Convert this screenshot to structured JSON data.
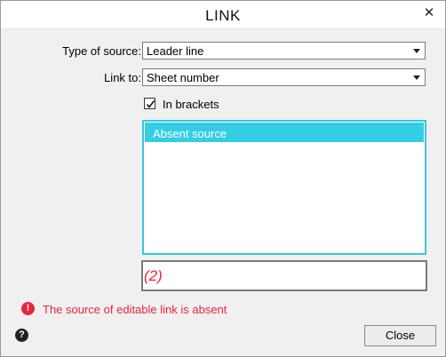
{
  "dialog": {
    "title": "LINK",
    "close_icon": "close-icon"
  },
  "form": {
    "type_of_source": {
      "label": "Type of source:",
      "value": "Leader line"
    },
    "link_to": {
      "label": "Link to:",
      "value": "Sheet number"
    },
    "in_brackets": {
      "label": "In brackets",
      "checked": true
    }
  },
  "source_list": {
    "items": [
      {
        "label": "Absent source",
        "selected": true
      }
    ]
  },
  "link_text": {
    "value": "(2)"
  },
  "error": {
    "icon": "exclamation-icon",
    "message": "The source of editable link is absent",
    "color": "#e8253a"
  },
  "footer": {
    "help_icon": "help-icon",
    "close_label": "Close"
  },
  "colors": {
    "accent": "#35cde3",
    "error": "#e8253a"
  }
}
